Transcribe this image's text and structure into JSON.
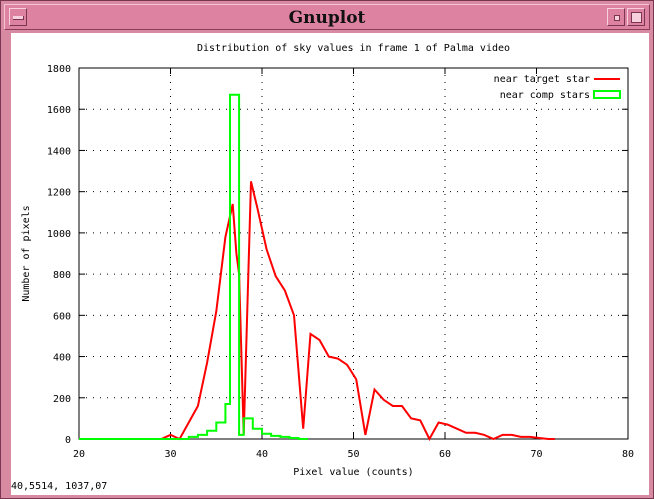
{
  "window": {
    "title": "Gnuplot",
    "menu_icon": "window-menu-icon",
    "minimize_icon": "minimize-icon",
    "maximize_icon": "maximize-icon",
    "frame_color": "#d98aa3"
  },
  "status": {
    "coords": "40,5514,  1037,07"
  },
  "chart_data": {
    "type": "line",
    "title": "Distribution of sky values in frame 1 of Palma video",
    "xlabel": "Pixel value (counts)",
    "ylabel": "Number of pixels",
    "xlim": [
      20,
      80
    ],
    "ylim": [
      0,
      1800
    ],
    "xticks": [
      20,
      30,
      40,
      50,
      60,
      70,
      80
    ],
    "yticks": [
      0,
      200,
      400,
      600,
      800,
      1000,
      1200,
      1400,
      1600,
      1800
    ],
    "grid": true,
    "legend_position": "top-right",
    "series": [
      {
        "name": "near target star",
        "style": "line",
        "color": "#ff0000",
        "x": [
          20,
          29,
          30,
          31,
          33,
          34,
          35,
          36,
          36.8,
          37.2,
          37.5,
          38,
          38.8,
          39.5,
          40.5,
          41.5,
          42.5,
          43.5,
          44.5,
          45.3,
          46.3,
          47.3,
          48.3,
          49.3,
          50.3,
          51.3,
          52.3,
          53.3,
          54.3,
          55.3,
          56.3,
          57.3,
          58.3,
          59.3,
          60.3,
          61.3,
          62.3,
          63.3,
          64.3,
          65.3,
          66.3,
          67.3,
          68.3,
          69.3,
          70.3,
          71.3,
          72
        ],
        "y": [
          0,
          0,
          20,
          0,
          160,
          370,
          620,
          980,
          1140,
          900,
          800,
          20,
          1250,
          1120,
          920,
          790,
          720,
          600,
          50,
          510,
          480,
          400,
          390,
          360,
          290,
          20,
          240,
          190,
          160,
          160,
          100,
          90,
          0,
          80,
          70,
          50,
          30,
          30,
          20,
          0,
          20,
          20,
          10,
          10,
          5,
          0,
          0
        ]
      },
      {
        "name": "near comp stars",
        "style": "steps",
        "color": "#00ff00",
        "x": [
          20,
          32,
          33,
          34,
          35,
          36,
          36.5,
          37.5,
          38,
          39,
          40,
          41,
          42,
          43,
          44,
          45
        ],
        "y": [
          0,
          10,
          20,
          40,
          80,
          170,
          1670,
          20,
          100,
          50,
          25,
          15,
          10,
          5,
          0,
          0
        ]
      }
    ]
  }
}
